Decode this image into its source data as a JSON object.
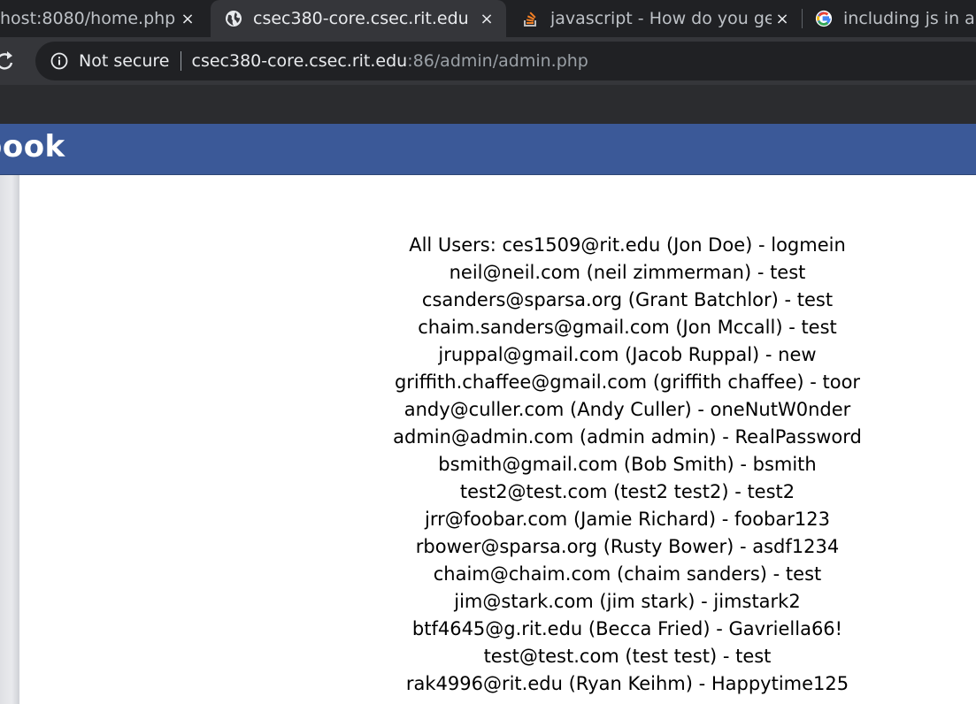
{
  "browser": {
    "tabs": [
      {
        "title": "host:8080/home.php",
        "active": false,
        "icon": "none"
      },
      {
        "title": "csec380-core.csec.rit.edu",
        "active": true,
        "icon": "globe-icon"
      },
      {
        "title": "javascript - How do you get",
        "active": false,
        "icon": "stackoverflow-icon"
      },
      {
        "title": "including js in a",
        "active": false,
        "icon": "google-icon"
      }
    ],
    "close_glyph": "×",
    "security_label": "Not secure",
    "url_host": "csec380-core.csec.rit.edu",
    "url_rest": ":86/admin/admin.php"
  },
  "site": {
    "header_color": "#3b5998",
    "logo_text": "book"
  },
  "users": {
    "prefix": "All Users:",
    "entries": [
      "ces1509@rit.edu (Jon Doe) - logmein",
      "neil@neil.com (neil zimmerman) - test",
      "csanders@sparsa.org (Grant Batchlor) - test",
      "chaim.sanders@gmail.com (Jon Mccall) - test",
      "jruppal@gmail.com (Jacob Ruppal) - new",
      "griffith.chaffee@gmail.com (griffith chaffee) - toor",
      "andy@culler.com (Andy Culler) - oneNutW0nder",
      "admin@admin.com (admin admin) - RealPassword",
      "bsmith@gmail.com (Bob Smith) - bsmith",
      "test2@test.com (test2 test2) - test2",
      "jrr@foobar.com (Jamie Richard) - foobar123",
      "rbower@sparsa.org (Rusty Bower) - asdf1234",
      "chaim@chaim.com (chaim sanders) - test",
      "jim@stark.com (jim stark) - jimstark2",
      "btf4645@g.rit.edu (Becca Fried) - Gavriella66!",
      "test@test.com (test test) - test",
      "rak4996@rit.edu (Ryan Keihm) - Happytime125"
    ]
  }
}
